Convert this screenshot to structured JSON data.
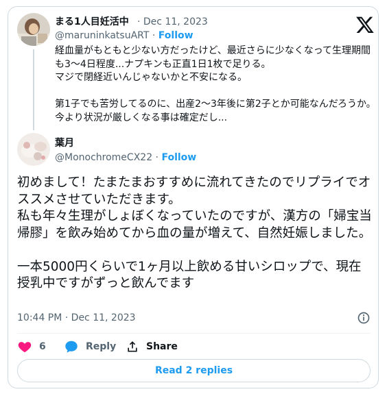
{
  "brand_colors": {
    "accent": "#1d9bf0",
    "like": "#f91880",
    "text": "#0f1419",
    "muted": "#536471",
    "border": "#cfd9de"
  },
  "quoted_post": {
    "author_name": "まる1人目妊活中",
    "date_separator": " · ",
    "date": "Dec 11, 2023",
    "handle": "@maruninkatsuART",
    "follow_separator": " · ",
    "follow_label": "Follow",
    "text": "経血量がもともと少ない方だったけど、最近さらに少なくなって生理期間も3〜4日程度...ナプキンも正直1日1枚で足りる。\nマジで閉経近いんじゃないかと不安になる。\n\n第1子でも苦労してるのに、出産2〜3年後に第2子とか可能なんだろうか。今より状況が厳しくなる事は確定だし..."
  },
  "reply_post": {
    "author_name": "葉月",
    "handle": "@MonochromeCX22",
    "follow_separator": " · ",
    "follow_label": "Follow",
    "text": "初めまして！たまたまおすすめに流れてきたのでリプライでオススメさせていただきます。\n私も年々生理がしょぼくなっていたのですが、漢方の「婦宝当帰膠」を飲み始めてから血の量が増えて、自然妊娠しました。\n\n一本5000円くらいで1ヶ月以上飲める甘いシロップで、現在授乳中ですがずっと飲んでます",
    "timestamp": "10:44 PM · Dec 11, 2023"
  },
  "actions": {
    "like_count": "6",
    "reply_label": "Reply",
    "share_label": "Share"
  },
  "read_replies_label": "Read 2 replies",
  "icons": [
    "x-logo-icon",
    "info-icon",
    "heart-icon",
    "reply-bubble-icon",
    "share-icon"
  ]
}
